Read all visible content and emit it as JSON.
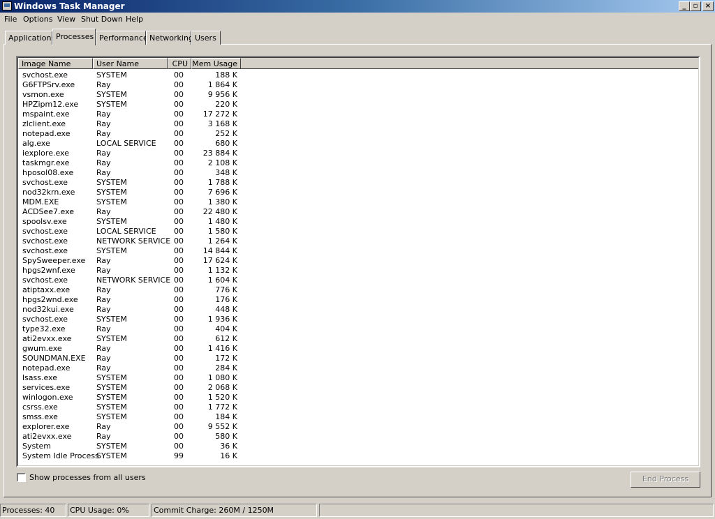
{
  "window": {
    "title": "Windows Task Manager",
    "controls": {
      "minimize": "_",
      "restore": "▫",
      "close": "×"
    }
  },
  "menu": {
    "items": [
      "File",
      "Options",
      "View",
      "Shut Down",
      "Help"
    ]
  },
  "tabs": [
    "Applications",
    "Processes",
    "Performance",
    "Networking",
    "Users"
  ],
  "active_tab": "Processes",
  "columns": {
    "image_name": "Image Name",
    "user_name": "User Name",
    "cpu": "CPU",
    "mem_usage": "Mem Usage"
  },
  "processes": [
    {
      "name": "svchost.exe",
      "user": "SYSTEM",
      "cpu": "00",
      "mem": "188 K"
    },
    {
      "name": "G6FTPSrv.exe",
      "user": "Ray",
      "cpu": "00",
      "mem": "1 864 K"
    },
    {
      "name": "vsmon.exe",
      "user": "SYSTEM",
      "cpu": "00",
      "mem": "9 956 K"
    },
    {
      "name": "HPZipm12.exe",
      "user": "SYSTEM",
      "cpu": "00",
      "mem": "220 K"
    },
    {
      "name": "mspaint.exe",
      "user": "Ray",
      "cpu": "00",
      "mem": "17 272 K"
    },
    {
      "name": "zlclient.exe",
      "user": "Ray",
      "cpu": "00",
      "mem": "3 168 K"
    },
    {
      "name": "notepad.exe",
      "user": "Ray",
      "cpu": "00",
      "mem": "252 K"
    },
    {
      "name": "alg.exe",
      "user": "LOCAL SERVICE",
      "cpu": "00",
      "mem": "680 K"
    },
    {
      "name": "iexplore.exe",
      "user": "Ray",
      "cpu": "00",
      "mem": "23 884 K"
    },
    {
      "name": "taskmgr.exe",
      "user": "Ray",
      "cpu": "00",
      "mem": "2 108 K"
    },
    {
      "name": "hposol08.exe",
      "user": "Ray",
      "cpu": "00",
      "mem": "348 K"
    },
    {
      "name": "svchost.exe",
      "user": "SYSTEM",
      "cpu": "00",
      "mem": "1 788 K"
    },
    {
      "name": "nod32krn.exe",
      "user": "SYSTEM",
      "cpu": "00",
      "mem": "7 696 K"
    },
    {
      "name": "MDM.EXE",
      "user": "SYSTEM",
      "cpu": "00",
      "mem": "1 380 K"
    },
    {
      "name": "ACDSee7.exe",
      "user": "Ray",
      "cpu": "00",
      "mem": "22 480 K"
    },
    {
      "name": "spoolsv.exe",
      "user": "SYSTEM",
      "cpu": "00",
      "mem": "1 480 K"
    },
    {
      "name": "svchost.exe",
      "user": "LOCAL SERVICE",
      "cpu": "00",
      "mem": "1 580 K"
    },
    {
      "name": "svchost.exe",
      "user": "NETWORK SERVICE",
      "cpu": "00",
      "mem": "1 264 K"
    },
    {
      "name": "svchost.exe",
      "user": "SYSTEM",
      "cpu": "00",
      "mem": "14 844 K"
    },
    {
      "name": "SpySweeper.exe",
      "user": "Ray",
      "cpu": "00",
      "mem": "17 624 K"
    },
    {
      "name": "hpgs2wnf.exe",
      "user": "Ray",
      "cpu": "00",
      "mem": "1 132 K"
    },
    {
      "name": "svchost.exe",
      "user": "NETWORK SERVICE",
      "cpu": "00",
      "mem": "1 604 K"
    },
    {
      "name": "atiptaxx.exe",
      "user": "Ray",
      "cpu": "00",
      "mem": "776 K"
    },
    {
      "name": "hpgs2wnd.exe",
      "user": "Ray",
      "cpu": "00",
      "mem": "176 K"
    },
    {
      "name": "nod32kui.exe",
      "user": "Ray",
      "cpu": "00",
      "mem": "448 K"
    },
    {
      "name": "svchost.exe",
      "user": "SYSTEM",
      "cpu": "00",
      "mem": "1 936 K"
    },
    {
      "name": "type32.exe",
      "user": "Ray",
      "cpu": "00",
      "mem": "404 K"
    },
    {
      "name": "ati2evxx.exe",
      "user": "SYSTEM",
      "cpu": "00",
      "mem": "612 K"
    },
    {
      "name": "gwum.exe",
      "user": "Ray",
      "cpu": "00",
      "mem": "1 416 K"
    },
    {
      "name": "SOUNDMAN.EXE",
      "user": "Ray",
      "cpu": "00",
      "mem": "172 K"
    },
    {
      "name": "notepad.exe",
      "user": "Ray",
      "cpu": "00",
      "mem": "284 K"
    },
    {
      "name": "lsass.exe",
      "user": "SYSTEM",
      "cpu": "00",
      "mem": "1 080 K"
    },
    {
      "name": "services.exe",
      "user": "SYSTEM",
      "cpu": "00",
      "mem": "2 068 K"
    },
    {
      "name": "winlogon.exe",
      "user": "SYSTEM",
      "cpu": "00",
      "mem": "1 520 K"
    },
    {
      "name": "csrss.exe",
      "user": "SYSTEM",
      "cpu": "00",
      "mem": "1 772 K"
    },
    {
      "name": "smss.exe",
      "user": "SYSTEM",
      "cpu": "00",
      "mem": "184 K"
    },
    {
      "name": "explorer.exe",
      "user": "Ray",
      "cpu": "00",
      "mem": "9 552 K"
    },
    {
      "name": "ati2evxx.exe",
      "user": "Ray",
      "cpu": "00",
      "mem": "580 K"
    },
    {
      "name": "System",
      "user": "SYSTEM",
      "cpu": "00",
      "mem": "36 K"
    },
    {
      "name": "System Idle Process",
      "user": "SYSTEM",
      "cpu": "99",
      "mem": "16 K"
    }
  ],
  "show_all_users": {
    "label": "Show processes from all users",
    "checked": false
  },
  "end_process_button": "End Process",
  "status": {
    "processes": "Processes: 40",
    "cpu_usage": "CPU Usage: 0%",
    "commit_charge": "Commit Charge: 260M / 1250M"
  }
}
